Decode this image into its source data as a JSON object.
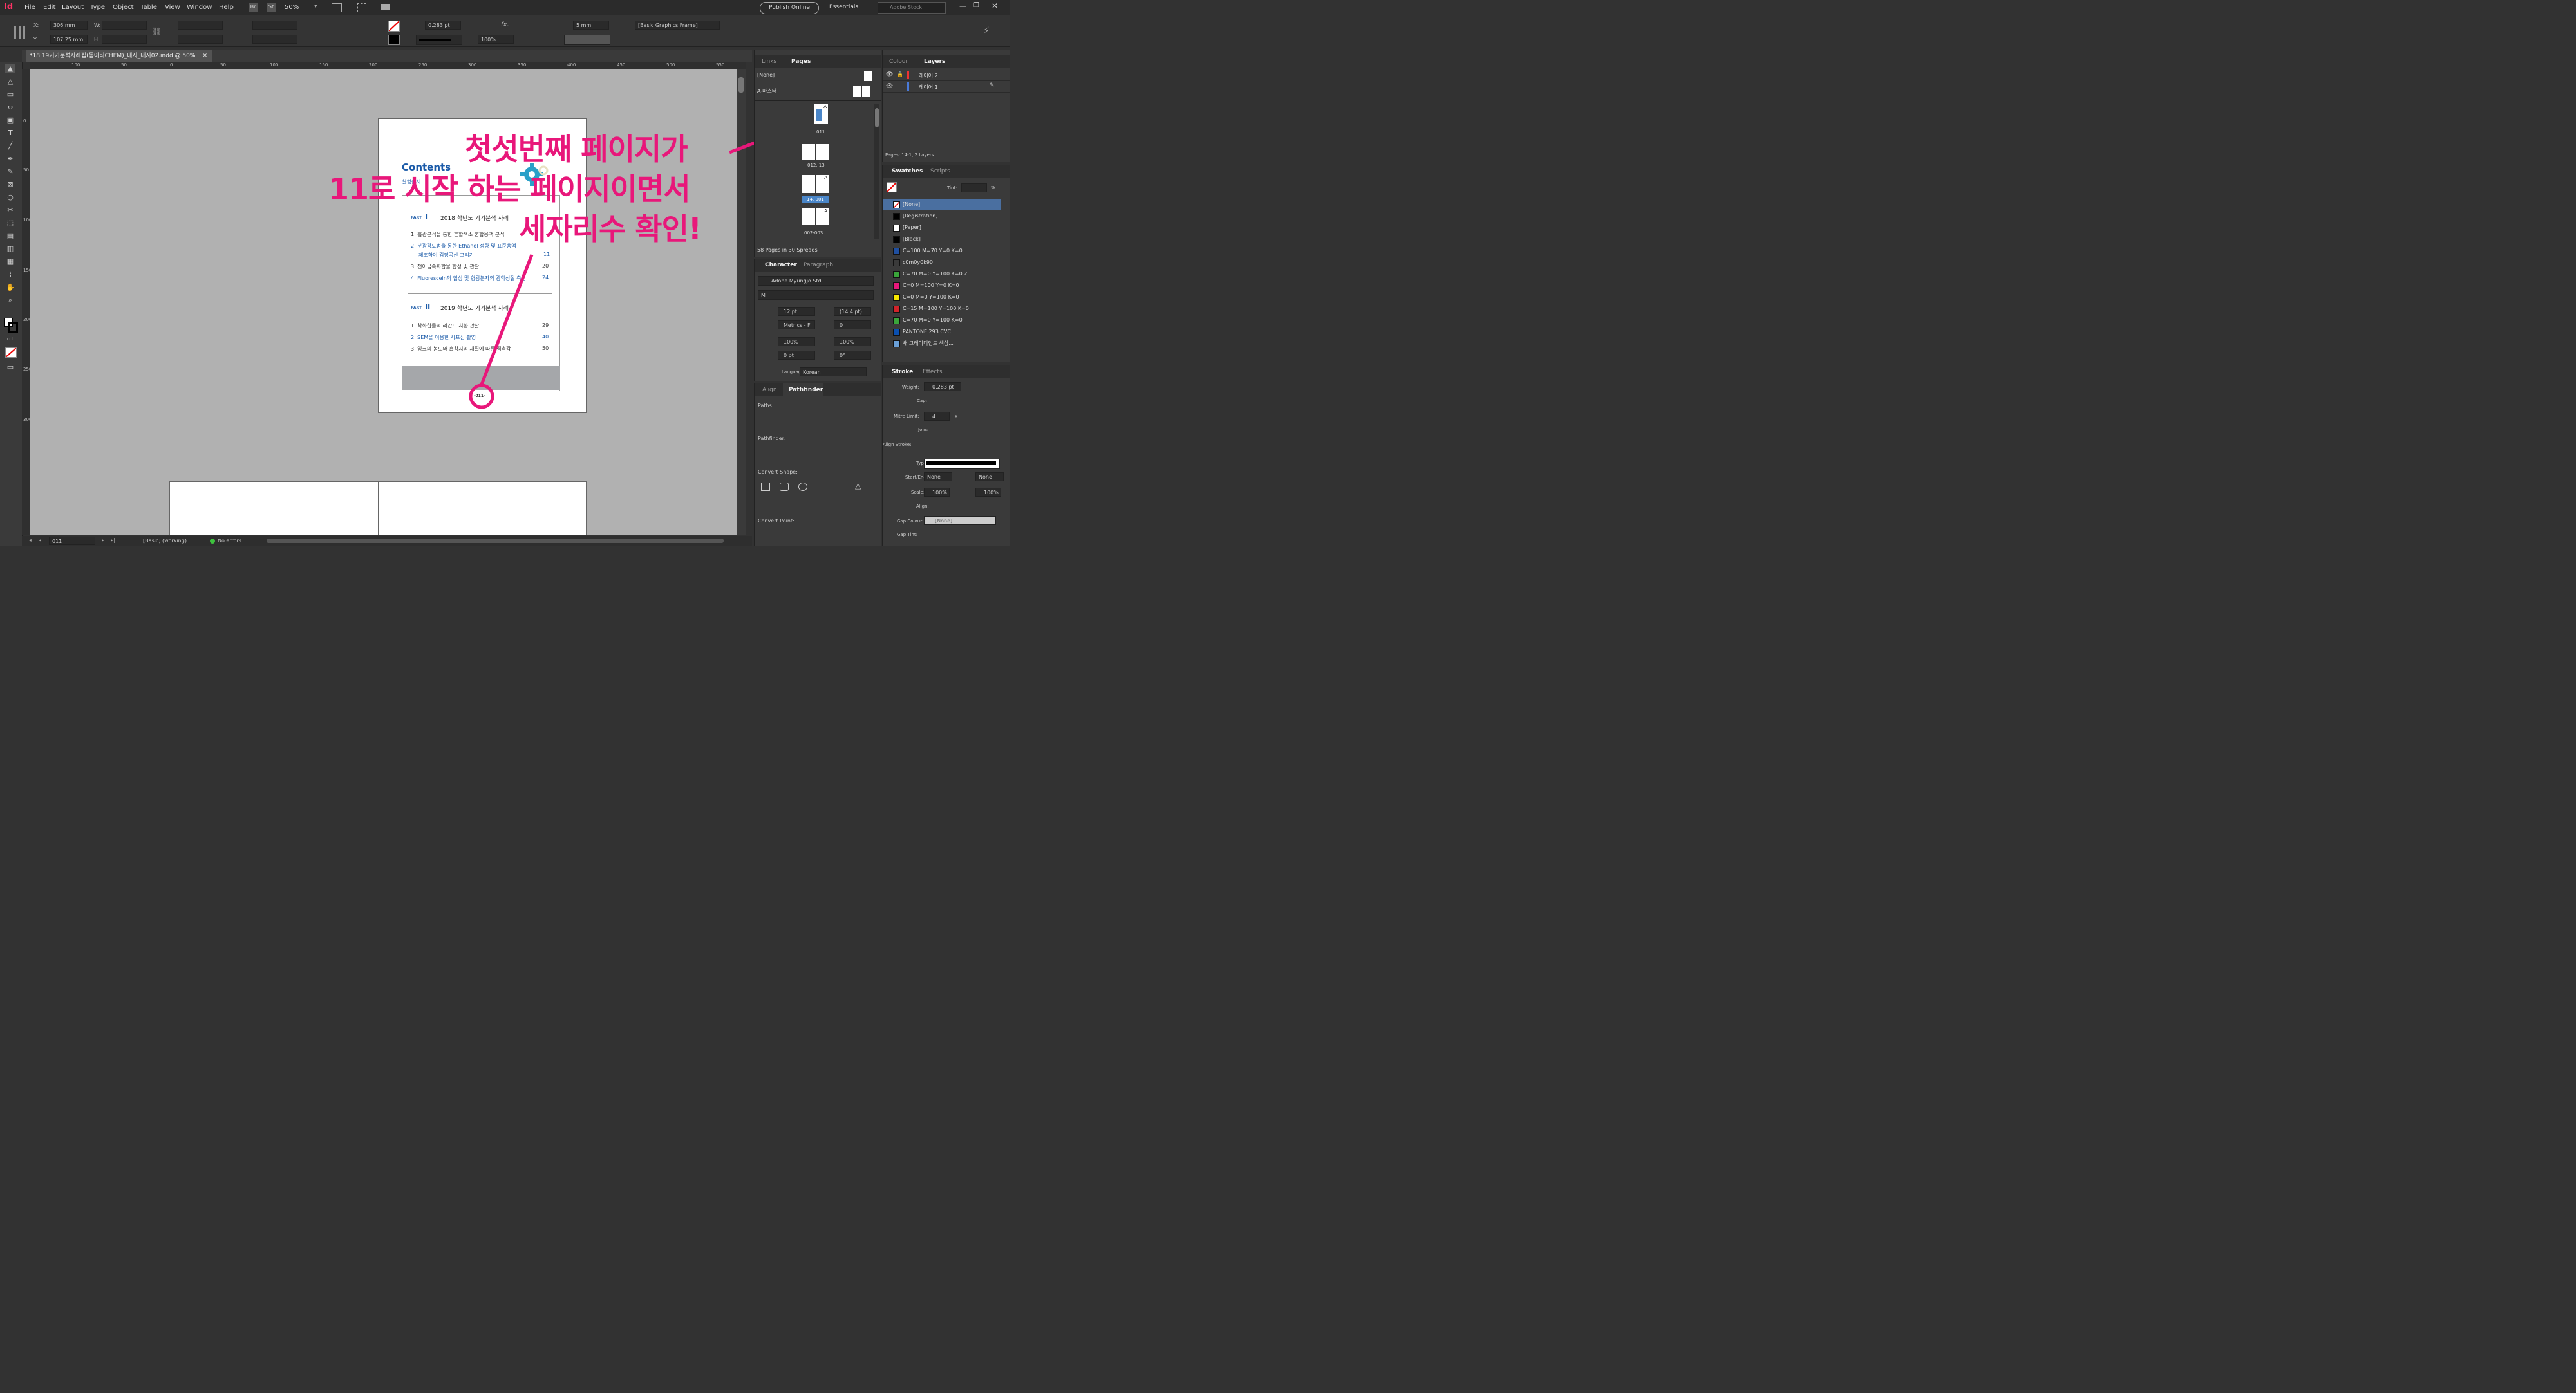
{
  "app": {
    "logo": "Id"
  },
  "menu": [
    "File",
    "Edit",
    "Layout",
    "Type",
    "Object",
    "Table",
    "View",
    "Window",
    "Help"
  ],
  "appbar": {
    "br": "Br",
    "st": "St",
    "zoom": "50%",
    "publish": "Publish Online",
    "workspace": "Essentials",
    "search_placeholder": "Adobe Stock"
  },
  "control": {
    "x_label": "X:",
    "x": "306 mm",
    "y_label": "Y:",
    "y": "107.25 mm",
    "w_label": "W:",
    "h_label": "H:",
    "stroke_weight": "0.283 pt",
    "opacity": "100%",
    "gap": "5 mm",
    "object_style": "[Basic Graphics Frame]"
  },
  "document": {
    "tab_title": "*18.19기기분석사례집(동아리CHEM)_내지_내지02.indd @ 50%"
  },
  "ruler": {
    "h": [
      "100",
      "50",
      "0",
      "50",
      "100",
      "150",
      "200",
      "250",
      "300",
      "350",
      "400",
      "450",
      "500",
      "550"
    ],
    "v": [
      "0",
      "50",
      "100",
      "150",
      "200",
      "250",
      "300"
    ]
  },
  "page": {
    "contents_title": "Contents",
    "contents_sub": "실험순서",
    "part1_label": "PART",
    "part1_numeral": "I",
    "part1_title": "2018 학년도 기기분석 사례",
    "part1_items": [
      {
        "text": "1. 흡광분석을 통한 혼합색소 혼합용액 분석",
        "page": "",
        "blue": false
      },
      {
        "text": "2. 분광광도법을 통한 Ethanol 정량 및 표준용액",
        "page": "",
        "blue": true
      },
      {
        "text": "제조하여 검정곡선 그리기",
        "page": "11",
        "blue": true
      },
      {
        "text": "3. 전이금속화합물 합성 및 관찰",
        "page": "20",
        "blue": false
      },
      {
        "text": "4. Fluorescein의 합성 및 형광분자의 광학성질 측정",
        "page": "24",
        "blue": true
      }
    ],
    "part2_label": "PART",
    "part2_numeral": "II",
    "part2_title": "2019 학년도 기기분석 사례",
    "part2_items": [
      {
        "text": "1. 착화합물의 리간드 치환 관찰",
        "page": "29",
        "blue": false
      },
      {
        "text": "2. SEM을 이용한 사프심 촬영",
        "page": "40",
        "blue": true
      },
      {
        "text": "3. 잉크의 농도와 흡착지의 재질에 따른 접촉각",
        "page": "50",
        "blue": false
      }
    ],
    "folio": "-011-"
  },
  "annotation": {
    "line1": "첫섯번째 페이지가",
    "line2": "11로 시작 하는 페이지이면서",
    "line3": "세자리수 확인!"
  },
  "panels": {
    "left_tabs": [
      "Links",
      "Pages"
    ],
    "pages_none": "[None]",
    "pages_master": "A-마스터",
    "thumbs": [
      {
        "label": "011",
        "badge": "A"
      },
      {
        "label": "012, 13",
        "badge": ""
      },
      {
        "label": "14, 001",
        "badge": "A"
      },
      {
        "label": "002-003",
        "badge": "A"
      }
    ],
    "pages_footer": "58 Pages in 30 Spreads",
    "right_tabs": [
      "Colour",
      "Layers"
    ],
    "layers": [
      "레이어 2",
      "레이어 1"
    ],
    "layers_footer": "Pages: 14-1, 2 Layers",
    "char_tabs": [
      "Character",
      "Paragraph"
    ],
    "font": "Adobe Myungjo Std",
    "font_style": "M",
    "size": "12 pt",
    "leading": "(14.4 pt)",
    "kerning": "Metrics - F",
    "tracking": "0",
    "vscale": "100%",
    "hscale": "100%",
    "baseline": "0 pt",
    "skew": "0°",
    "language_label": "Language:",
    "language": "Korean",
    "swatches_tabs": [
      "Swatches",
      "Scripts"
    ],
    "tint_label": "Tint:",
    "tint_unit": "%",
    "swatches": [
      {
        "name": "[None]",
        "color": "#ffffff",
        "selected": true
      },
      {
        "name": "[Registration]",
        "color": "#000000",
        "selected": false
      },
      {
        "name": "[Paper]",
        "color": "#ffffff",
        "selected": false
      },
      {
        "name": "[Black]",
        "color": "#000000",
        "selected": false
      },
      {
        "name": "C=100 M=70 Y=0 K=0",
        "color": "#1f4fa0",
        "selected": false
      },
      {
        "name": "c0m0y0k90",
        "color": "#3a3a3a",
        "selected": false
      },
      {
        "name": "C=70 M=0 Y=100 K=0 2",
        "color": "#3aa53a",
        "selected": false
      },
      {
        "name": "C=0 M=100 Y=0 K=0",
        "color": "#e8177a",
        "selected": false
      },
      {
        "name": "C=0 M=0 Y=100 K=0",
        "color": "#f5e600",
        "selected": false
      },
      {
        "name": "C=15 M=100 Y=100 K=0",
        "color": "#d2232a",
        "selected": false
      },
      {
        "name": "C=70 M=0 Y=100 K=0",
        "color": "#3aa53a",
        "selected": false
      },
      {
        "name": "PANTONE 293 CVC",
        "color": "#0a4fb0",
        "selected": false
      },
      {
        "name": "새 그레이디언트 색상...",
        "color": "#6aa0d8",
        "selected": false
      }
    ],
    "align_tabs": [
      "Align",
      "Pathfinder"
    ],
    "paths_label": "Paths:",
    "pathfinder_label": "Pathfinder:",
    "convert_shape_label": "Convert Shape:",
    "convert_point_label": "Convert Point:",
    "stroke_tabs": [
      "Stroke",
      "Effects"
    ],
    "stroke": {
      "weight_label": "Weight:",
      "weight": "0.283 pt",
      "cap_label": "Cap:",
      "mitre_label": "Mitre Limit:",
      "mitre": "4",
      "mitre_unit": "x",
      "join_label": "Join:",
      "align_label": "Align Stroke:",
      "type_label": "Type:",
      "startend_label": "Start/End:",
      "start": "None",
      "end": "None",
      "scale_label": "Scale:",
      "scale1": "100%",
      "scale2": "100%",
      "align2_label": "Align:",
      "gapcolour_label": "Gap Colour:",
      "gapcolour": "[None]",
      "gaptint_label": "Gap Tint:"
    }
  },
  "status": {
    "page": "011",
    "preflight_profile": "[Basic] (working)",
    "errors": "No errors"
  },
  "colors": {
    "accent": "#e8177a",
    "blue": "#1a5aa8"
  }
}
